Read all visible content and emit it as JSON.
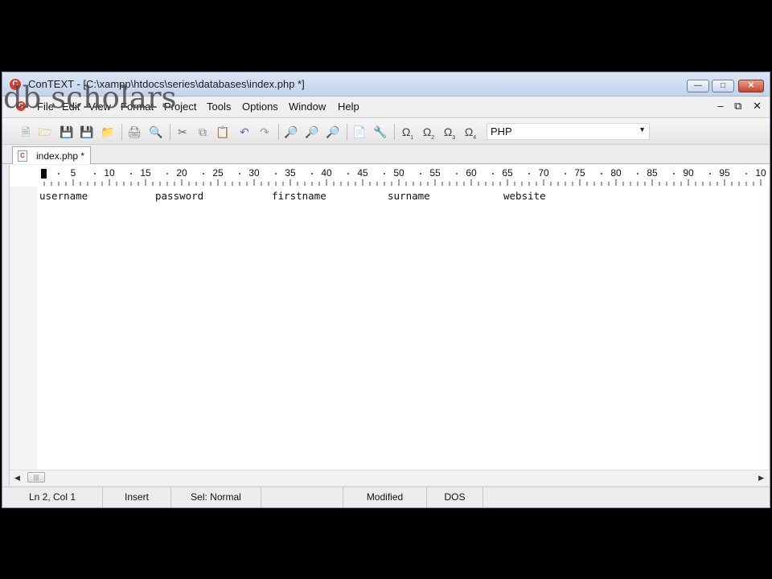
{
  "window": {
    "title": "ConTEXT - [C:\\xampp\\htdocs\\series\\databases\\index.php *]",
    "app_icon": "context-app-icon"
  },
  "watermark": "db scholars",
  "menu": {
    "items": [
      "File",
      "Edit",
      "View",
      "Format",
      "Project",
      "Tools",
      "Options",
      "Window",
      "Help"
    ]
  },
  "toolbar": {
    "icons": [
      "new-file-icon",
      "open-file-icon",
      "save-icon",
      "save-all-icon",
      "open-folder-icon",
      "print-icon",
      "print-preview-icon",
      "cut-icon",
      "copy-icon",
      "paste-icon",
      "undo-icon",
      "redo-icon",
      "find-icon",
      "find-next-icon",
      "replace-icon",
      "export-icon",
      "tools-icon",
      "user-command-1-icon",
      "user-command-2-icon",
      "user-command-3-icon",
      "user-command-4-icon"
    ],
    "user_command_numbers": [
      "1",
      "2",
      "3",
      "4"
    ],
    "highlighter": "PHP"
  },
  "tabs": [
    {
      "label": "index.php *"
    }
  ],
  "ruler": {
    "labels": [
      "5",
      "10",
      "15",
      "20",
      "25",
      "30",
      "35",
      "40",
      "45",
      "50",
      "55",
      "60",
      "65",
      "70",
      "75",
      "80",
      "85",
      "90",
      "95",
      "10"
    ]
  },
  "editor": {
    "columns": [
      "username",
      "password",
      "firstname",
      "surname",
      "website"
    ]
  },
  "status": {
    "position": "Ln 2, Col 1",
    "mode": "Insert",
    "selection": "Sel: Normal",
    "modified": "Modified",
    "format": "DOS"
  }
}
